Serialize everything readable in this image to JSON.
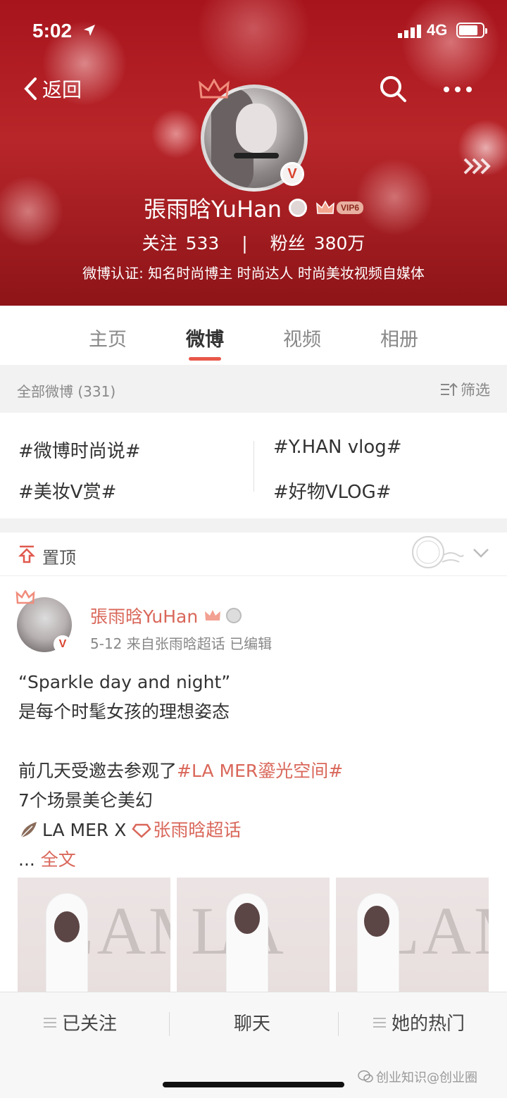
{
  "status": {
    "time": "5:02",
    "network": "4G"
  },
  "nav": {
    "back_label": "返回"
  },
  "profile": {
    "name": "張雨晗YuHan",
    "vip_level": "VIP6",
    "follow_label": "关注",
    "follow_count": "533",
    "separator": "|",
    "fans_label": "粉丝",
    "fans_count": "380万",
    "verification": "微博认证: 知名时尚博主 时尚达人 时尚美妆视频自媒体",
    "verified_badge": "V"
  },
  "tabs": [
    {
      "label": "主页",
      "active": false
    },
    {
      "label": "微博",
      "active": true
    },
    {
      "label": "视频",
      "active": false
    },
    {
      "label": "相册",
      "active": false
    }
  ],
  "filter": {
    "count_label": "全部微博 (331)",
    "filter_label": "筛选"
  },
  "topics": [
    "#微博时尚说#",
    "#Y.HAN vlog#",
    "#美妆V赏#",
    "#好物VLOG#"
  ],
  "pinned": {
    "label": "置顶"
  },
  "post": {
    "author": "張雨晗YuHan",
    "meta": "5-12  来自张雨晗超话  已编辑",
    "lines": {
      "l1": "“Sparkle day and night”",
      "l2": "是每个时髦女孩的理想姿态",
      "l3_prefix": "前几天受邀去参观了",
      "l3_link": "#LA MER鎏光空间#",
      "l4": "7个场景美仑美幻",
      "l5_prefix": "LA MER X ",
      "l5_link": "张雨晗超话",
      "l6_dots": "... ",
      "l6_more": "全文"
    },
    "image_letters": [
      "LAM",
      "LA",
      "LAM"
    ]
  },
  "bottom_bar": {
    "following": "已关注",
    "chat": "聊天",
    "hot": "她的热门"
  },
  "watermark": "创业知识@创业圈",
  "colors": {
    "brand_red": "#d9675a",
    "accent": "#e8574a"
  }
}
